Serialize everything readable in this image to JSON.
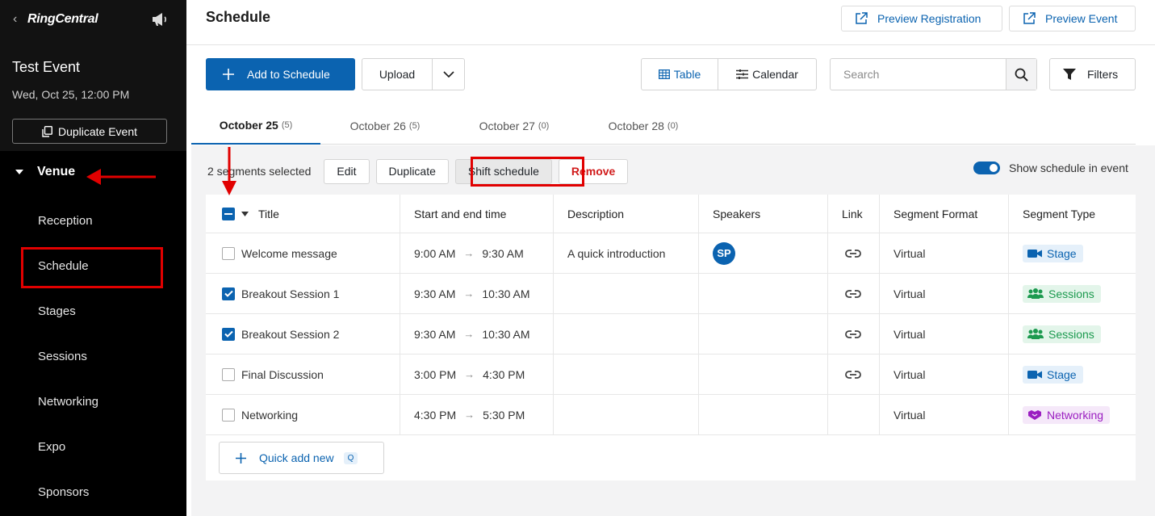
{
  "sidebar": {
    "brand": "RingCentral",
    "event_title": "Test Event",
    "event_date": "Wed, Oct 25, 12:00 PM",
    "duplicate_label": "Duplicate Event",
    "section_label": "Venue",
    "items": [
      {
        "label": "Reception"
      },
      {
        "label": "Schedule"
      },
      {
        "label": "Stages"
      },
      {
        "label": "Sessions"
      },
      {
        "label": "Networking"
      },
      {
        "label": "Expo"
      },
      {
        "label": "Sponsors"
      }
    ]
  },
  "header": {
    "title": "Schedule",
    "preview_registration": "Preview Registration",
    "preview_event": "Preview Event"
  },
  "toolbar": {
    "add_label": "Add to Schedule",
    "upload_label": "Upload",
    "table_label": "Table",
    "calendar_label": "Calendar",
    "search_placeholder": "Search",
    "filters_label": "Filters"
  },
  "tabs": [
    {
      "label": "October 25",
      "count": "(5)"
    },
    {
      "label": "October 26",
      "count": "(5)"
    },
    {
      "label": "October 27",
      "count": "(0)"
    },
    {
      "label": "October 28",
      "count": "(0)"
    }
  ],
  "selection": {
    "text": "2 segments selected",
    "edit": "Edit",
    "duplicate": "Duplicate",
    "shift": "Shift schedule",
    "remove": "Remove",
    "toggle_label": "Show schedule in event"
  },
  "table": {
    "columns": [
      "Title",
      "Start and end time",
      "Description",
      "Speakers",
      "Link",
      "Segment Format",
      "Segment Type"
    ],
    "rows": [
      {
        "title": "Welcome message",
        "start": "9:00 AM",
        "end": "9:30 AM",
        "description": "A quick introduction",
        "speaker": "SP",
        "format": "Virtual",
        "type": "Stage"
      },
      {
        "title": "Breakout Session 1",
        "start": "9:30 AM",
        "end": "10:30 AM",
        "description": "",
        "speaker": "",
        "format": "Virtual",
        "type": "Sessions"
      },
      {
        "title": "Breakout Session 2",
        "start": "9:30 AM",
        "end": "10:30 AM",
        "description": "",
        "speaker": "",
        "format": "Virtual",
        "type": "Sessions"
      },
      {
        "title": "Final Discussion",
        "start": "3:00 PM",
        "end": "4:30 PM",
        "description": "",
        "speaker": "",
        "format": "Virtual",
        "type": "Stage"
      },
      {
        "title": "Networking",
        "start": "4:30 PM",
        "end": "5:30 PM",
        "description": "",
        "speaker": "",
        "format": "Virtual",
        "type": "Networking"
      }
    ]
  },
  "quick_add": {
    "label": "Quick add new",
    "shortcut": "Q"
  },
  "colors": {
    "accent": "#0b63b0",
    "danger": "#d11b1b",
    "annotation": "#e10000"
  }
}
